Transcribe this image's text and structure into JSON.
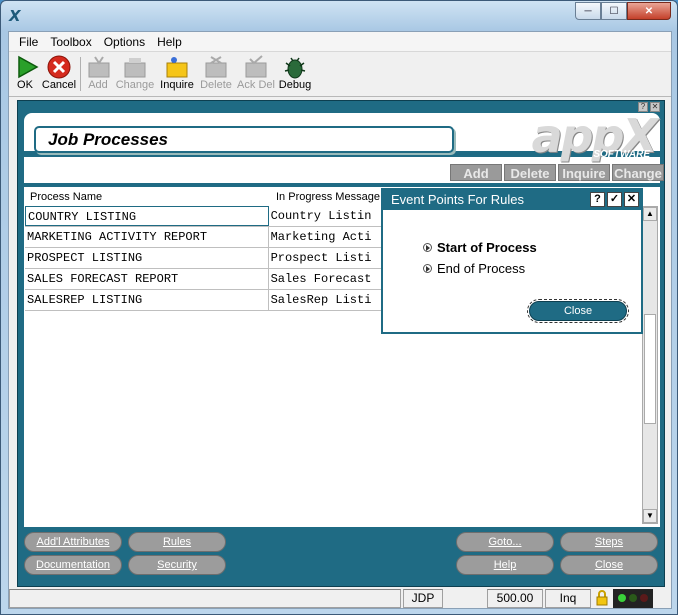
{
  "menu": [
    "File",
    "Toolbox",
    "Options",
    "Help"
  ],
  "toolbar": [
    {
      "label": "OK",
      "icon": "green-arrow-icon",
      "enabled": true
    },
    {
      "label": "Cancel",
      "icon": "red-x-icon",
      "enabled": true
    },
    {
      "label": "Add",
      "icon": "add-icon",
      "enabled": false
    },
    {
      "label": "Change",
      "icon": "change-icon",
      "enabled": false
    },
    {
      "label": "Inquire",
      "icon": "folder-icon",
      "enabled": true
    },
    {
      "label": "Delete",
      "icon": "delete-icon",
      "enabled": false
    },
    {
      "label": "Ack Del",
      "icon": "ack-del-icon",
      "enabled": false
    },
    {
      "label": "Debug",
      "icon": "bug-icon",
      "enabled": true
    }
  ],
  "header": {
    "title": "Job Processes",
    "logo": "appX",
    "logo_sub": "SOFTWARE",
    "tabs": [
      "Add",
      "Delete",
      "Inquire",
      "Change"
    ]
  },
  "grid": {
    "columns": [
      "Process Name",
      "In Progress Message"
    ],
    "rows": [
      [
        "COUNTRY LISTING",
        "Country Listin"
      ],
      [
        "MARKETING ACTIVITY REPORT",
        "Marketing Acti"
      ],
      [
        "PROSPECT LISTING",
        "Prospect Listi"
      ],
      [
        "SALES FORECAST REPORT",
        "Sales Forecast"
      ],
      [
        "SALESREP LISTING",
        "SalesRep Listi"
      ]
    ]
  },
  "buttons": {
    "addl_attributes": "Add'l Attributes",
    "rules": "Rules",
    "documentation": "Documentation",
    "security": "Security",
    "goto": "Goto...",
    "help": "Help",
    "steps": "Steps",
    "close": "Close"
  },
  "dialog": {
    "title": "Event Points For Rules",
    "options": [
      "Start of Process",
      "End of Process"
    ],
    "close": "Close"
  },
  "status": {
    "user": "JDP",
    "version": "500.00",
    "mode": "Inq"
  },
  "colors": {
    "accent": "#1f6b84",
    "button_gray": "#9c9c9c"
  }
}
